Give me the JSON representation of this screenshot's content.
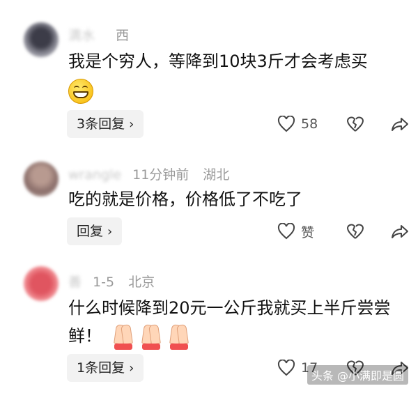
{
  "comments": [
    {
      "user_name": "滴水",
      "time": "",
      "location": "西",
      "text": "我是个穷人，等降到10块3斤才会考虑买",
      "emoji": "grinning-face",
      "reply_label": "3条回复",
      "likes": "58",
      "avatar_color": "#6f6f7a"
    },
    {
      "user_name": "wrangle",
      "time": "11分钟前",
      "location": "湖北",
      "text": "吃的就是价格，价格低了不吃了",
      "reply_label": "回复",
      "likes": "赞",
      "avatar_color": "#8a6e6a"
    },
    {
      "user_name": "善",
      "time": "1-5",
      "location": "北京",
      "text": "什么时候降到20元一公斤我就买上半斤尝尝鲜！",
      "emoji": "folded-hands",
      "reply_label": "1条回复",
      "likes": "17",
      "avatar_color": "#e0505a"
    }
  ],
  "watermark": "头条 @小满即是圆"
}
